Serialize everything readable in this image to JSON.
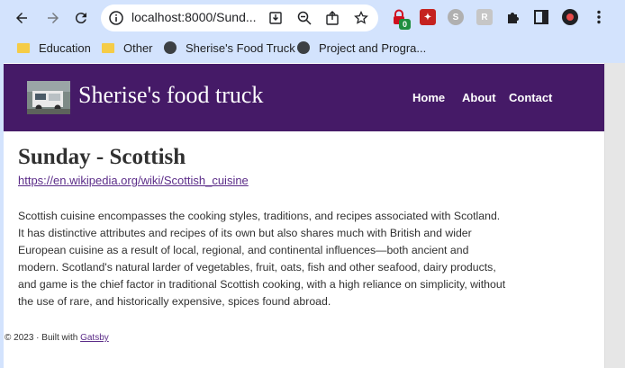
{
  "browser": {
    "url": "localhost:8000/Sund...",
    "extension_badge_count": "0",
    "bookmarks": [
      {
        "label": "Education",
        "icon": "folder-icon"
      },
      {
        "label": "Other",
        "icon": "folder-icon"
      },
      {
        "label": "Sherise's Food Truck",
        "icon": "globe-icon"
      },
      {
        "label": "Project and Progra...",
        "icon": "globe-icon"
      }
    ]
  },
  "site": {
    "title": "Sherise's food truck",
    "nav": [
      "Home",
      "About",
      "Contact"
    ]
  },
  "main": {
    "heading": "Sunday - Scottish",
    "link": "https://en.wikipedia.org/wiki/Scottish_cuisine",
    "paragraph": "Scottish cuisine encompasses the cooking styles, traditions, and recipes associated with Scotland. It has distinctive attributes and recipes of its own but also shares much with British and wider European cuisine as a result of local, regional, and continental influences—both ancient and modern. Scotland's natural larder of vegetables, fruit, oats, fish and other seafood, dairy products, and game is the chief factor in traditional Scottish cooking, with a high reliance on simplicity, without the use of rare, and historically expensive, spices found abroad."
  },
  "footer": {
    "text": "© 2023 · Built with",
    "link": "Gatsby"
  },
  "colors": {
    "header_bg": "#451a67",
    "link": "#5b2c88",
    "chrome_bg": "#d3e3fd"
  }
}
